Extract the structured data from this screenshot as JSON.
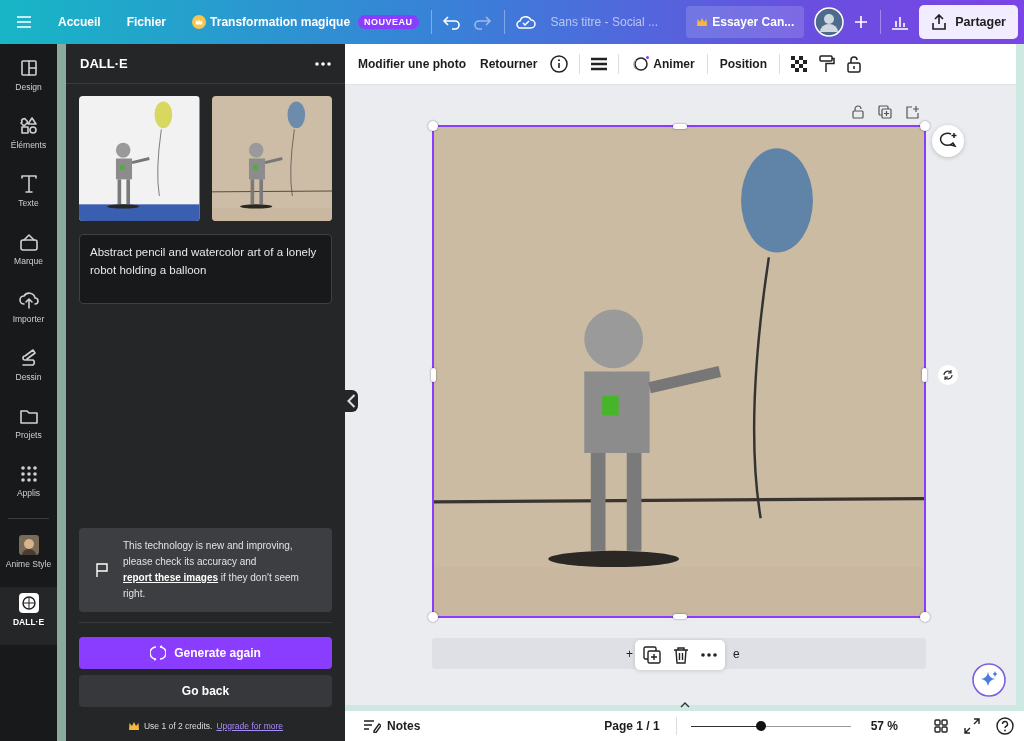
{
  "topbar": {
    "links": [
      "Accueil",
      "Fichier"
    ],
    "magic": {
      "label": "Transformation magique",
      "badge": "NOUVEAU"
    },
    "doc_title": "Sans titre - Social ...",
    "try_button": "Essayer Can...",
    "share_button": "Partager"
  },
  "rail": [
    {
      "label": "Design",
      "selected": false
    },
    {
      "label": "Éléments",
      "selected": false
    },
    {
      "label": "Texte",
      "selected": false
    },
    {
      "label": "Marque",
      "selected": false
    },
    {
      "label": "Importer",
      "selected": false
    },
    {
      "label": "Dessin",
      "selected": false
    },
    {
      "label": "Projets",
      "selected": false
    },
    {
      "label": "Applis",
      "selected": false
    },
    {
      "label": "Anime Style",
      "selected": false
    },
    {
      "label": "DALL·E",
      "selected": true
    }
  ],
  "panel": {
    "title": "DALL·E",
    "prompt": "Abstract pencil and watercolor art of a lonely robot holding a balloon",
    "notice_before": "This technology is new and improving, please check its accuracy and",
    "notice_link": "report these images",
    "notice_after": "if they don't seem right.",
    "generate_button": "Generate again",
    "back_button": "Go back",
    "credits": "Use 1 of 2 credits.",
    "upgrade_link": "Upgrade for more"
  },
  "toolbar": {
    "edit_photo": "Modifier une photo",
    "flip": "Retourner",
    "animate": "Animer",
    "position": "Position"
  },
  "canvas": {
    "add_page_left": "+",
    "add_page_right": "e"
  },
  "footer": {
    "notes": "Notes",
    "page": "Page 1 / 1",
    "zoom": {
      "level": 0.44,
      "reading": "57 %"
    }
  }
}
